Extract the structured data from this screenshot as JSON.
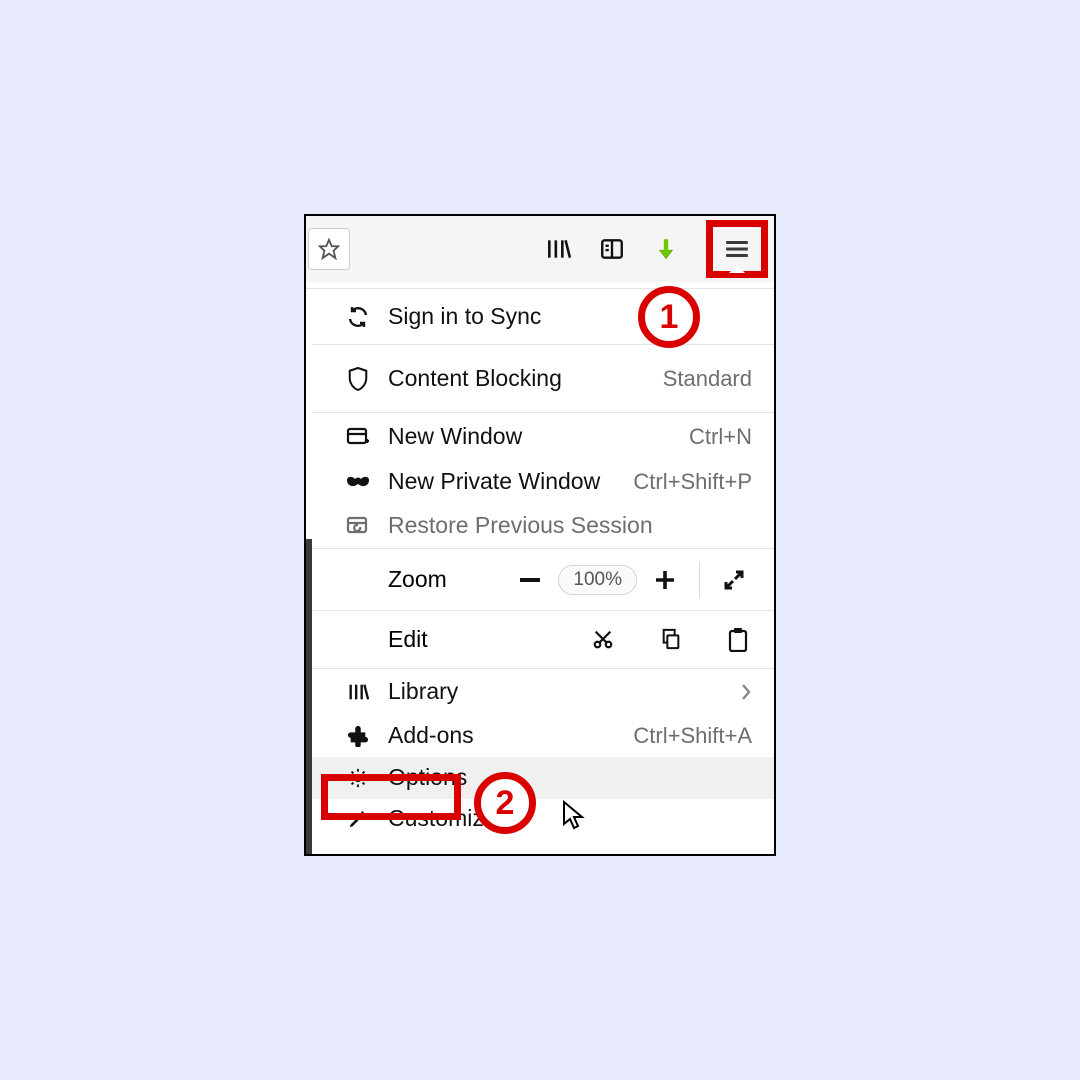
{
  "toolbar": {
    "downloads_color": "#73c702"
  },
  "annotations": {
    "badge1": "1",
    "badge2": "2",
    "highlight_color": "#d90000"
  },
  "menu": {
    "sync_label": "Sign in to Sync",
    "content_blocking_label": "Content Blocking",
    "content_blocking_value": "Standard",
    "new_window_label": "New Window",
    "new_window_shortcut": "Ctrl+N",
    "new_private_label": "New Private Window",
    "new_private_shortcut": "Ctrl+Shift+P",
    "restore_session_label": "Restore Previous Session",
    "zoom_label": "Zoom",
    "zoom_value": "100%",
    "edit_label": "Edit",
    "library_label": "Library",
    "addons_label": "Add-ons",
    "addons_shortcut": "Ctrl+Shift+A",
    "options_label": "Options",
    "customize_label": "Customize..."
  }
}
